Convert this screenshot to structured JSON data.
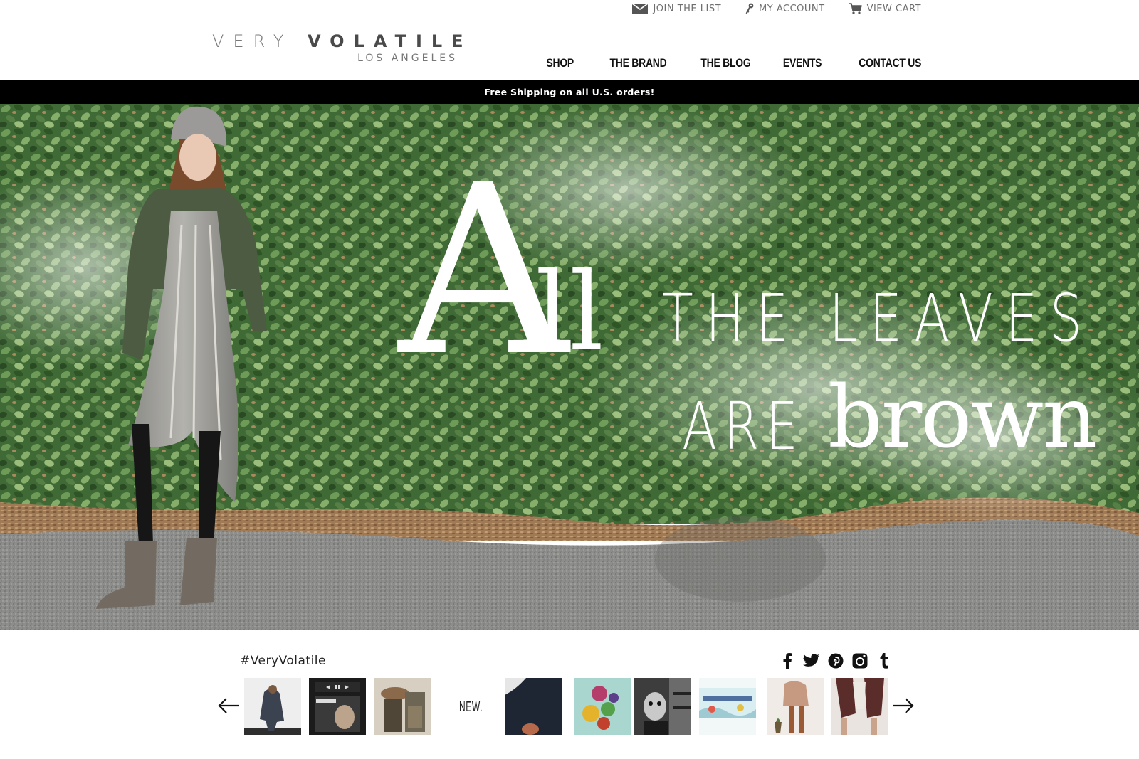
{
  "utility_nav": {
    "join_list": "JOIN THE LIST",
    "my_account": "MY ACCOUNT",
    "view_cart": "VIEW CART"
  },
  "logo": {
    "word1": "VERY",
    "word2": "VOLATILE",
    "subtitle": "LOS ANGELES"
  },
  "main_nav": [
    "SHOP",
    "THE BRAND",
    "THE BLOG",
    "EVENTS",
    "CONTACT US"
  ],
  "promo": {
    "text": "Free Shipping on all U.S. orders!"
  },
  "hero": {
    "big_letter": "A",
    "ll": "ll",
    "line1": "THE LEAVES",
    "line2_a": "ARE",
    "line2_b": "brown"
  },
  "instagram": {
    "hashtag": "#VeryVolatile",
    "new_label": "NEW."
  },
  "social_icons": [
    "facebook-icon",
    "twitter-icon",
    "pinterest-icon",
    "instagram-icon",
    "tumblr-icon"
  ]
}
